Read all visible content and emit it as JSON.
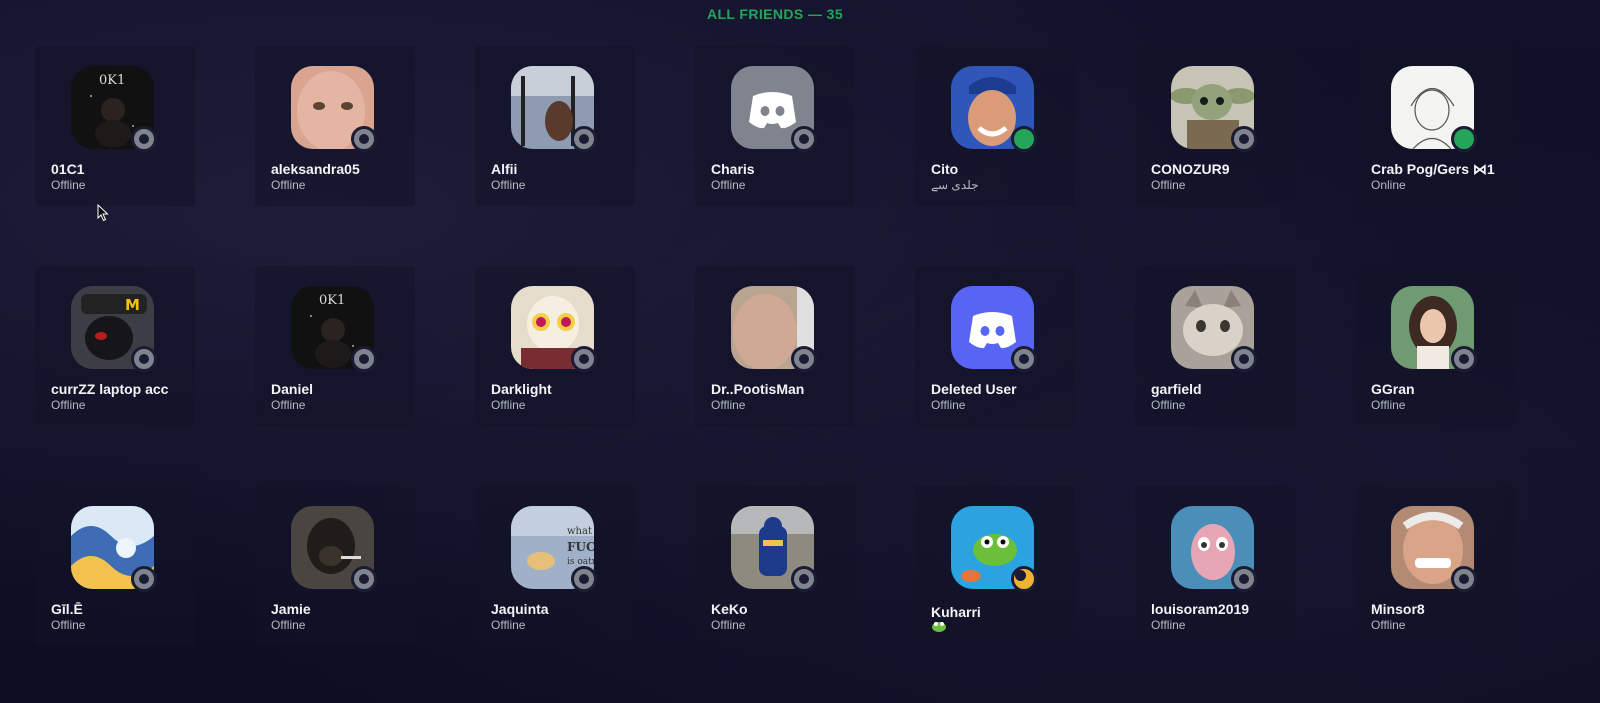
{
  "header": {
    "title": "ALL FRIENDS — 35"
  },
  "colors": {
    "accent_green": "#23a55a",
    "status_offline": "#80848e",
    "status_online": "#23a55a",
    "status_idle": "#f0b232",
    "discord_blurple": "#5865f2"
  },
  "friends": [
    {
      "name": "01C1",
      "subtitle": "Offline",
      "status": "offline",
      "avatar": "dark-character-avatar"
    },
    {
      "name": "aleksandra05",
      "subtitle": "Offline",
      "status": "offline",
      "avatar": "face-photo-avatar"
    },
    {
      "name": "Alfii",
      "subtitle": "Offline",
      "status": "offline",
      "avatar": "photo-avatar"
    },
    {
      "name": "Charis",
      "subtitle": "Offline",
      "status": "offline",
      "avatar": "discord-grey-default-avatar"
    },
    {
      "name": "Cito",
      "subtitle": "جلدی سے",
      "status": "online",
      "avatar": "face-photo-avatar"
    },
    {
      "name": "CONOZUR9",
      "subtitle": "Offline",
      "status": "offline",
      "avatar": "grogu-avatar"
    },
    {
      "name": "Crab Pog/Gers ⋈1",
      "subtitle": "Online",
      "status": "online",
      "avatar": "sketch-avatar"
    },
    {
      "name": "currZZ laptop acc",
      "subtitle": "Offline",
      "status": "offline",
      "avatar": "character-avatar"
    },
    {
      "name": "Daniel",
      "subtitle": "Offline",
      "status": "offline",
      "avatar": "dark-character-avatar"
    },
    {
      "name": "Darklight",
      "subtitle": "Offline",
      "status": "offline",
      "avatar": "cartoon-avatar"
    },
    {
      "name": "Dr..PootisMan",
      "subtitle": "Offline",
      "status": "offline",
      "avatar": "face-photo-avatar"
    },
    {
      "name": "Deleted User",
      "subtitle": "Offline",
      "status": "offline",
      "avatar": "discord-blurple-default-avatar"
    },
    {
      "name": "garfield",
      "subtitle": "Offline",
      "status": "offline",
      "avatar": "cat-photo-avatar"
    },
    {
      "name": "GGran",
      "subtitle": "Offline",
      "status": "offline",
      "avatar": "photo-avatar"
    },
    {
      "name": "Gīl.Ē",
      "subtitle": "Offline",
      "status": "offline",
      "avatar": "wave-art-avatar"
    },
    {
      "name": "Jamie",
      "subtitle": "Offline",
      "status": "offline",
      "avatar": "monkey-photo-avatar"
    },
    {
      "name": "Jaquinta",
      "subtitle": "Offline",
      "status": "offline",
      "avatar": "meme-avatar"
    },
    {
      "name": "KeKo",
      "subtitle": "Offline",
      "status": "offline",
      "avatar": "racing-photo-avatar"
    },
    {
      "name": "Kuharri",
      "subtitle": "",
      "status": "idle",
      "avatar": "frog-cartoon-avatar"
    },
    {
      "name": "louisoram2019",
      "subtitle": "Offline",
      "status": "offline",
      "avatar": "cartoon-girl-avatar"
    },
    {
      "name": "Minsor8",
      "subtitle": "Offline",
      "status": "offline",
      "avatar": "smiling-man-photo-avatar"
    }
  ]
}
